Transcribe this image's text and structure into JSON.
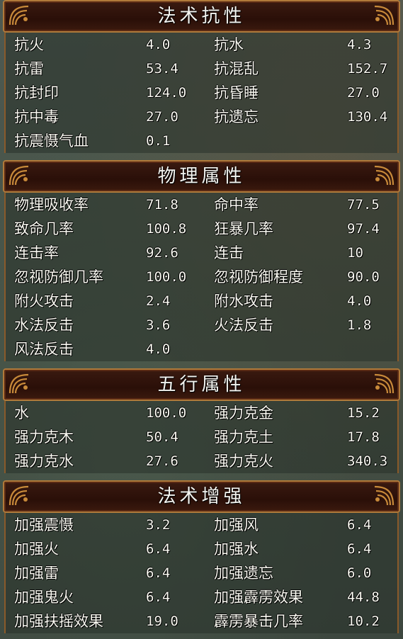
{
  "sections": [
    {
      "title": "法术抗性",
      "rows": [
        [
          {
            "label": "抗火",
            "value": "4.0"
          },
          {
            "label": "抗水",
            "value": "4.3"
          }
        ],
        [
          {
            "label": "抗雷",
            "value": "53.4"
          },
          {
            "label": "抗混乱",
            "value": "152.7"
          }
        ],
        [
          {
            "label": "抗封印",
            "value": "124.0"
          },
          {
            "label": "抗昏睡",
            "value": "27.0"
          }
        ],
        [
          {
            "label": "抗中毒",
            "value": "27.0"
          },
          {
            "label": "抗遗忘",
            "value": "130.4"
          }
        ],
        [
          {
            "label": "抗震慑气血",
            "value": "0.1"
          },
          {
            "label": "",
            "value": ""
          }
        ]
      ]
    },
    {
      "title": "物理属性",
      "rows": [
        [
          {
            "label": "物理吸收率",
            "value": "71.8"
          },
          {
            "label": "命中率",
            "value": "77.5"
          }
        ],
        [
          {
            "label": "致命几率",
            "value": "100.8"
          },
          {
            "label": "狂暴几率",
            "value": "97.4"
          }
        ],
        [
          {
            "label": "连击率",
            "value": "92.6"
          },
          {
            "label": "连击",
            "value": "10"
          }
        ],
        [
          {
            "label": "忽视防御几率",
            "value": "100.0"
          },
          {
            "label": "忽视防御程度",
            "value": "90.0"
          }
        ],
        [
          {
            "label": "附火攻击",
            "value": "2.4"
          },
          {
            "label": "附水攻击",
            "value": "4.0"
          }
        ],
        [
          {
            "label": "水法反击",
            "value": "3.6"
          },
          {
            "label": "火法反击",
            "value": "1.8"
          }
        ],
        [
          {
            "label": "风法反击",
            "value": "4.0"
          },
          {
            "label": "",
            "value": ""
          }
        ]
      ]
    },
    {
      "title": "五行属性",
      "rows": [
        [
          {
            "label": "水",
            "value": "100.0"
          },
          {
            "label": "强力克金",
            "value": "15.2"
          }
        ],
        [
          {
            "label": "强力克木",
            "value": "50.4"
          },
          {
            "label": "强力克土",
            "value": "17.8"
          }
        ],
        [
          {
            "label": "强力克水",
            "value": "27.6"
          },
          {
            "label": "强力克火",
            "value": "340.3"
          }
        ]
      ]
    },
    {
      "title": "法术增强",
      "rows": [
        [
          {
            "label": "加强震慑",
            "value": "3.2"
          },
          {
            "label": "加强风",
            "value": "6.4"
          }
        ],
        [
          {
            "label": "加强火",
            "value": "6.4"
          },
          {
            "label": "加强水",
            "value": "6.4"
          }
        ],
        [
          {
            "label": "加强雷",
            "value": "6.4"
          },
          {
            "label": "加强遗忘",
            "value": "6.0"
          }
        ],
        [
          {
            "label": "加强鬼火",
            "value": "6.4"
          },
          {
            "label": "加强霹雳效果",
            "value": "44.8"
          }
        ],
        [
          {
            "label": "加强扶摇效果",
            "value": "19.0"
          },
          {
            "label": "霹雳暴击几率",
            "value": "10.2"
          }
        ]
      ]
    }
  ],
  "colors": {
    "header_bg": "#2a0f08",
    "frame": "#b07a3a",
    "text": "#fafaf2"
  }
}
